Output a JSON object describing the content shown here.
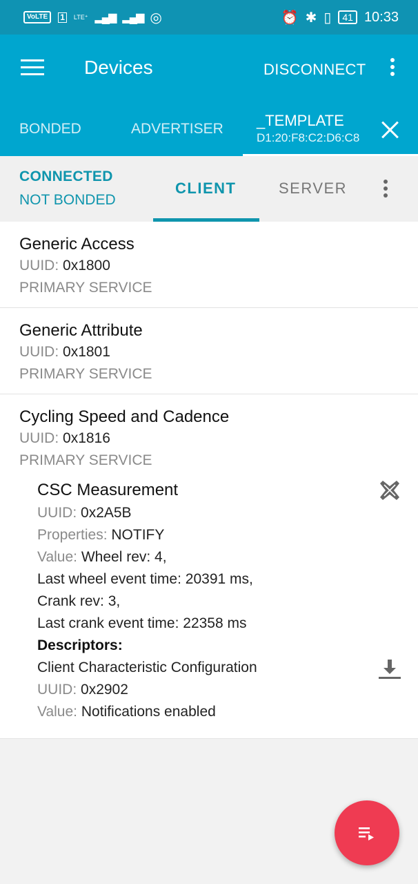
{
  "status_bar": {
    "volte": "VoLTE",
    "sim": "1",
    "lte": "LTE⁺",
    "battery": "41",
    "time": "10:33"
  },
  "toolbar": {
    "title": "Devices",
    "disconnect_label": "DISCONNECT"
  },
  "device_tabs": {
    "bonded": "BONDED",
    "advertiser": "ADVERTISER",
    "active_name": "_TEMPLATE",
    "active_address": "D1:20:F8:C2:D6:C8"
  },
  "connection": {
    "state": "CONNECTED",
    "bond": "NOT BONDED"
  },
  "sub_tabs": {
    "client": "CLIENT",
    "server": "SERVER"
  },
  "labels": {
    "uuid": "UUID:",
    "properties": "Properties:",
    "value": "Value:",
    "descriptors": "Descriptors:"
  },
  "services": [
    {
      "name": "Generic Access",
      "uuid": "0x1800",
      "type": "PRIMARY SERVICE"
    },
    {
      "name": "Generic Attribute",
      "uuid": "0x1801",
      "type": "PRIMARY SERVICE"
    },
    {
      "name": "Cycling Speed and Cadence",
      "uuid": "0x1816",
      "type": "PRIMARY SERVICE"
    }
  ],
  "characteristic": {
    "name": "CSC Measurement",
    "uuid": "0x2A5B",
    "properties": "NOTIFY",
    "value_lines": [
      "Wheel rev: 4,",
      "Last wheel event time: 20391 ms,",
      "Crank rev: 3,",
      "Last crank event time: 22358 ms"
    ]
  },
  "descriptor": {
    "name": "Client Characteristic Configuration",
    "uuid": "0x2902",
    "value": "Notifications enabled"
  },
  "colors": {
    "status_bar": "#0f93b3",
    "app_bar": "#00a6cf",
    "accent": "#0f95ad",
    "fab": "#ef3b52"
  }
}
